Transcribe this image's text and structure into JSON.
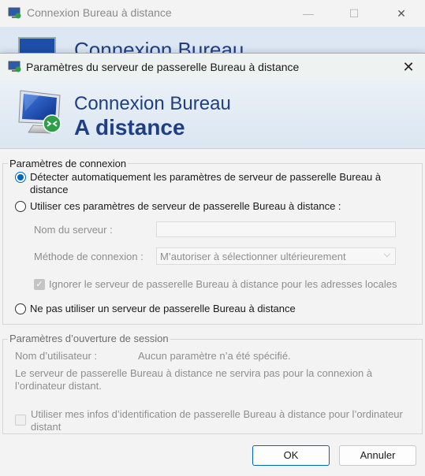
{
  "background_window": {
    "title": "Connexion Bureau à distance",
    "banner_title": "Connexion Bureau",
    "minimize": "—",
    "maximize": "☐",
    "close": "✕"
  },
  "dialog": {
    "title": "Paramètres du serveur de passerelle Bureau à distance",
    "close": "✕",
    "banner_line1": "Connexion Bureau",
    "banner_line2": "A distance"
  },
  "connection": {
    "legend": "Paramètres de connexion",
    "auto_detect_line1": "Détecter automatiquement les paramètres de serveur de passerelle Bureau à",
    "auto_detect_line2": "distance",
    "use_settings": "Utiliser ces paramètres de serveur de passerelle Bureau à distance :",
    "server_name_label": "Nom du serveur :",
    "server_name_value": "",
    "method_label": "Méthode de connexion :",
    "method_value": "M’autoriser à sélectionner ultérieurement",
    "bypass_local": "Ignorer le serveur de passerelle Bureau à distance pour les adresses locales",
    "no_gateway": "Ne pas utiliser un serveur de passerelle Bureau à distance"
  },
  "logon": {
    "legend": "Paramètres d’ouverture de session",
    "username_label": "Nom d’utilisateur :",
    "username_value": "Aucun paramètre n’a été spécifié.",
    "info_line1": "Le serveur de passerelle Bureau à distance ne servira pas pour la connexion à",
    "info_line2": "l’ordinateur distant.",
    "use_creds_line1": "Utiliser mes infos d’identification de passerelle Bureau à distance pour l’ordinateur",
    "use_creds_line2": "distant"
  },
  "buttons": {
    "ok": "OK",
    "cancel": "Annuler"
  },
  "state": {
    "selected_option": "auto_detect",
    "bypass_local_checked": true,
    "use_creds_checked": false
  },
  "colors": {
    "accent": "#0067c0",
    "banner_text": "#1f3f85"
  }
}
